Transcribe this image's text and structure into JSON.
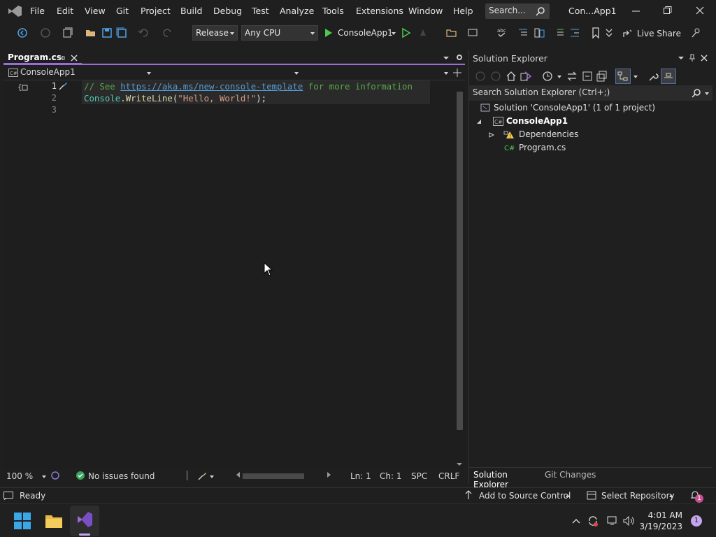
{
  "menu": {
    "items": [
      "File",
      "Edit",
      "View",
      "Git",
      "Project",
      "Build",
      "Debug",
      "Test",
      "Analyze",
      "Tools",
      "Extensions",
      "Window",
      "Help"
    ],
    "search_placeholder": "Search...",
    "window_title": "Con...App1"
  },
  "toolbar": {
    "configuration": "Release",
    "platform": "Any CPU",
    "run_target": "ConsoleApp1",
    "live_share": "Live Share"
  },
  "editor": {
    "tab_label": "Program.cs",
    "nav_project": "ConsoleApp1",
    "line_numbers": [
      "1",
      "2",
      "3"
    ],
    "line1": {
      "comment_prefix": "// See ",
      "link": "https://aka.ms/new-console-template",
      "comment_suffix": " for more information"
    },
    "line2": {
      "type": "Console",
      "dot": ".",
      "method": "WriteLine",
      "open": "(",
      "string": "\"Hello, World!\"",
      "close": ");"
    },
    "zoom": "100 %",
    "issues": "No issues found",
    "ln": "Ln: 1",
    "ch": "Ch: 1",
    "spc": "SPC",
    "crlf": "CRLF"
  },
  "solution_explorer": {
    "title": "Solution Explorer",
    "search_placeholder": "Search Solution Explorer (Ctrl+;)",
    "solution_label": "Solution 'ConsoleApp1' (1 of 1 project)",
    "project_label": "ConsoleApp1",
    "dependencies_label": "Dependencies",
    "file_label": "Program.cs",
    "tab_solution_explorer": "Solution Explorer",
    "tab_git_changes": "Git Changes"
  },
  "statusbar": {
    "ready": "Ready",
    "add_to_source": "Add to Source Control",
    "select_repo": "Select Repository",
    "notification_count": "1"
  },
  "taskbar": {
    "time": "4:01 AM",
    "date": "3/19/2023",
    "badge": "1"
  },
  "colors": {
    "accent": "#9b6bd6",
    "run_green": "#4ec94e",
    "comment": "#57a64a",
    "link": "#569cd6",
    "type": "#4ec9b0"
  }
}
